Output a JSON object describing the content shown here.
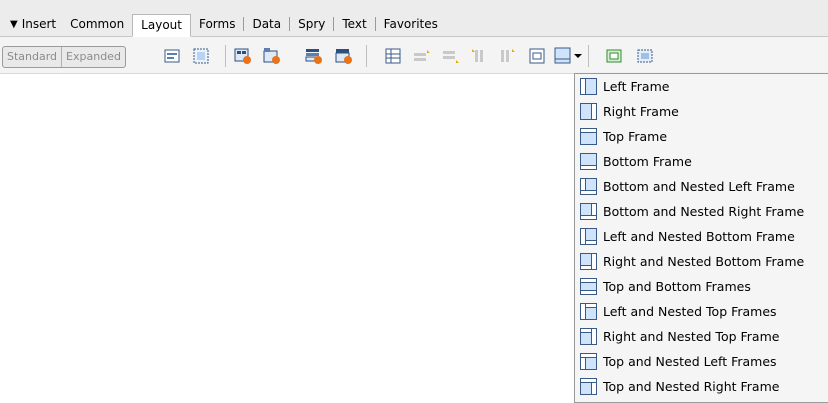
{
  "panel": {
    "title": "Insert"
  },
  "tabs": [
    {
      "label": "Common"
    },
    {
      "label": "Layout"
    },
    {
      "label": "Forms"
    },
    {
      "label": "Data"
    },
    {
      "label": "Spry"
    },
    {
      "label": "Text"
    },
    {
      "label": "Favorites"
    }
  ],
  "active_tab": "Layout",
  "modes": {
    "standard": "Standard",
    "expanded": "Expanded"
  },
  "colors": {
    "accent": "#cfe3fb",
    "frame_stroke": "#3a5a86",
    "panel_bg": "#ececec"
  },
  "menu": {
    "items": [
      {
        "label": "Left Frame",
        "icon": "left-frame-icon"
      },
      {
        "label": "Right Frame",
        "icon": "right-frame-icon"
      },
      {
        "label": "Top Frame",
        "icon": "top-frame-icon"
      },
      {
        "label": "Bottom Frame",
        "icon": "bottom-frame-icon"
      },
      {
        "label": "Bottom and Nested Left Frame",
        "icon": "bottom-nested-left-frame-icon"
      },
      {
        "label": "Bottom and Nested Right Frame",
        "icon": "bottom-nested-right-frame-icon"
      },
      {
        "label": "Left and Nested Bottom Frame",
        "icon": "left-nested-bottom-frame-icon"
      },
      {
        "label": "Right and Nested Bottom Frame",
        "icon": "right-nested-bottom-frame-icon"
      },
      {
        "label": "Top and Bottom Frames",
        "icon": "top-bottom-frames-icon"
      },
      {
        "label": "Left and Nested Top Frames",
        "icon": "left-nested-top-frames-icon"
      },
      {
        "label": "Right and Nested Top Frame",
        "icon": "right-nested-top-frame-icon"
      },
      {
        "label": "Top and Nested Left Frames",
        "icon": "top-nested-left-frames-icon"
      },
      {
        "label": "Top and Nested Right Frame",
        "icon": "top-nested-right-frame-icon"
      }
    ]
  }
}
